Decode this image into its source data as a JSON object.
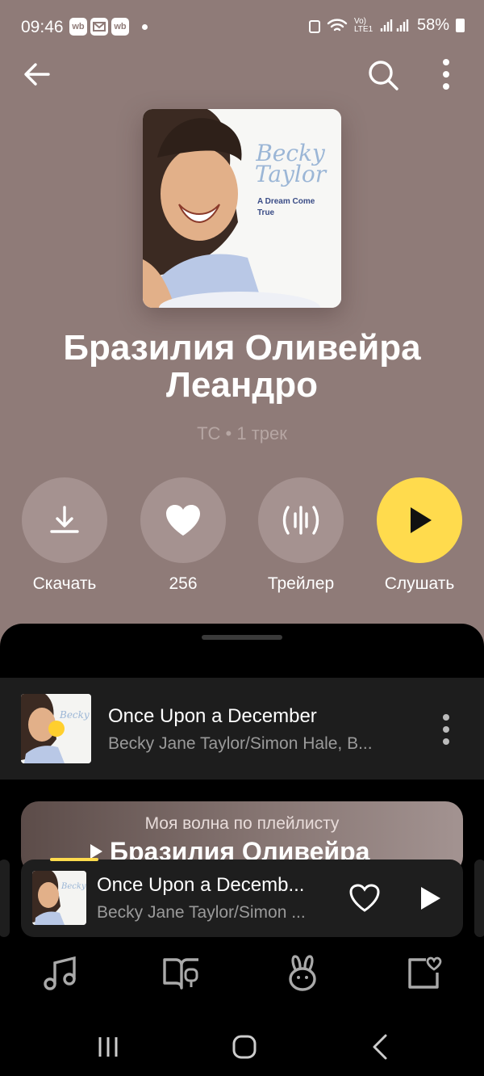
{
  "status_bar": {
    "time": "09:46",
    "left_badges": [
      "wb",
      "",
      "wb"
    ],
    "network": "Vo) LTE1",
    "battery": "58%"
  },
  "playlist": {
    "title": "Бразилия Оливейра Леандро",
    "meta": "ТС • 1 трек",
    "cover": {
      "artist_logo": "Becky Taylor",
      "album_text": "A Dream Come True"
    }
  },
  "actions": [
    {
      "label": "Скачать",
      "icon": "download-icon"
    },
    {
      "label": "256",
      "icon": "heart-icon"
    },
    {
      "label": "Трейлер",
      "icon": "waveform-icon"
    },
    {
      "label": "Слушать",
      "icon": "play-icon"
    }
  ],
  "track": {
    "title": "Once Upon a December",
    "artist": "Becky Jane Taylor/Simon Hale, B..."
  },
  "wave": {
    "label": "Моя волна по плейлисту",
    "name": "Бразилия Оливейра"
  },
  "mini_player": {
    "title": "Once Upon a Decemb...",
    "artist": "Becky Jane Taylor/Simon ..."
  },
  "bottom_nav": [
    "music-note-icon",
    "book-icon",
    "kids-bunny-icon",
    "collection-heart-icon"
  ],
  "colors": {
    "header_bg": "#8f7b78",
    "accent": "#ffdb4d",
    "sheet_bg": "#000000"
  }
}
